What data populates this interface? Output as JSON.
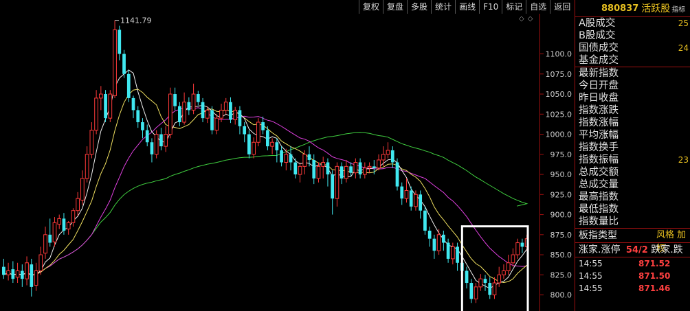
{
  "toolbar": {
    "buttons": [
      "复权",
      "复盘",
      "多股",
      "统计",
      "画线",
      "F10",
      "标记",
      "自选",
      "返回"
    ]
  },
  "header": {
    "code": "880837",
    "name": "活跃股",
    "badge": "指标"
  },
  "chart": {
    "corner_icons": "◇◇",
    "max_label": "1141.79"
  },
  "panel": {
    "rows": [
      {
        "label": "A股成交",
        "value": "25"
      },
      {
        "label": "B股成交",
        "value": ""
      },
      {
        "label": "国债成交",
        "value": "24"
      },
      {
        "label": "基金成交",
        "value": ""
      },
      {
        "label": "最新指数",
        "value": ""
      },
      {
        "label": "今日开盘",
        "value": ""
      },
      {
        "label": "昨日收盘",
        "value": ""
      },
      {
        "label": "指数涨跌",
        "value": ""
      },
      {
        "label": "指数涨幅",
        "value": ""
      },
      {
        "label": "平均涨幅",
        "value": ""
      },
      {
        "label": "指数换手",
        "value": ""
      },
      {
        "label": "指数振幅",
        "value": "23"
      },
      {
        "label": "总成交额",
        "value": ""
      },
      {
        "label": "总成交量",
        "value": ""
      },
      {
        "label": "最高指数",
        "value": ""
      },
      {
        "label": "最低指数",
        "value": ""
      },
      {
        "label": "指数量比",
        "value": ""
      }
    ],
    "style_label": "板指类型",
    "style_value": "风格 加权",
    "rise_label": "涨家.涨停",
    "rise_value": "54/2",
    "fall_label": "跌家.跌",
    "ticks": [
      {
        "time": "14:55",
        "price": "871.52"
      },
      {
        "time": "14:55",
        "price": "871.50"
      },
      {
        "time": "14:55",
        "price": "871.46"
      }
    ]
  },
  "colors": {
    "up": "#ff3a3a",
    "down": "#40e8f0",
    "ma5": "#f0f0f0",
    "ma10": "#f0e060",
    "ma20": "#e040e0",
    "ma60": "#40d040",
    "axis": "#a01010",
    "highlight": "#ffffff"
  },
  "chart_data": {
    "type": "candlestick",
    "ylim": [
      780,
      1150
    ],
    "yticks": [
      800,
      825,
      850,
      875,
      900,
      925,
      950,
      975,
      1000,
      1025,
      1050,
      1075,
      1100
    ],
    "candles": [
      [
        835,
        825,
        845,
        820
      ],
      [
        825,
        830,
        840,
        818
      ],
      [
        832,
        820,
        842,
        815
      ],
      [
        822,
        830,
        840,
        815
      ],
      [
        830,
        820,
        838,
        810
      ],
      [
        820,
        840,
        848,
        812
      ],
      [
        838,
        810,
        845,
        798
      ],
      [
        812,
        830,
        840,
        805
      ],
      [
        830,
        850,
        860,
        825
      ],
      [
        852,
        875,
        885,
        845
      ],
      [
        875,
        865,
        895,
        860
      ],
      [
        866,
        890,
        897,
        860
      ],
      [
        888,
        895,
        900,
        882
      ],
      [
        895,
        880,
        902,
        875
      ],
      [
        882,
        890,
        892,
        875
      ],
      [
        890,
        905,
        908,
        885
      ],
      [
        905,
        920,
        928,
        898
      ],
      [
        918,
        945,
        955,
        912
      ],
      [
        945,
        975,
        985,
        940
      ],
      [
        975,
        1005,
        1015,
        970
      ],
      [
        1005,
        1045,
        1055,
        1000
      ],
      [
        1045,
        1050,
        1060,
        1030
      ],
      [
        1050,
        1020,
        1055,
        1015
      ],
      [
        1020,
        1050,
        1055,
        1015
      ],
      [
        1048,
        1130,
        1141.79,
        1045
      ],
      [
        1130,
        1100,
        1135,
        1092
      ],
      [
        1100,
        1075,
        1105,
        1070
      ],
      [
        1075,
        1045,
        1080,
        1040
      ],
      [
        1045,
        1030,
        1048,
        1020
      ],
      [
        1030,
        1015,
        1035,
        1008
      ],
      [
        1015,
        1005,
        1020,
        995
      ],
      [
        1005,
        990,
        1012,
        985
      ],
      [
        990,
        975,
        995,
        965
      ],
      [
        975,
        1000,
        1005,
        970
      ],
      [
        1000,
        985,
        1008,
        980
      ],
      [
        985,
        1000,
        1010,
        978
      ],
      [
        1000,
        1050,
        1058,
        995
      ],
      [
        1050,
        1035,
        1058,
        1030
      ],
      [
        1035,
        1015,
        1040,
        1010
      ],
      [
        1015,
        1040,
        1052,
        1012
      ],
      [
        1040,
        1030,
        1046,
        1024
      ],
      [
        1030,
        1050,
        1063,
        1025
      ],
      [
        1050,
        1040,
        1054,
        1036
      ],
      [
        1040,
        1020,
        1045,
        1015
      ],
      [
        1020,
        1030,
        1034,
        1014
      ],
      [
        1030,
        1005,
        1035,
        1000
      ],
      [
        1005,
        1020,
        1025,
        1000
      ],
      [
        1020,
        1030,
        1038,
        1015
      ],
      [
        1030,
        1040,
        1045,
        1025
      ],
      [
        1040,
        1018,
        1046,
        1014
      ],
      [
        1018,
        1030,
        1034,
        1012
      ],
      [
        1030,
        1010,
        1035,
        1000
      ],
      [
        1010,
        1000,
        1015,
        990
      ],
      [
        1000,
        975,
        1005,
        970
      ],
      [
        975,
        990,
        996,
        970
      ],
      [
        990,
        1015,
        1020,
        985
      ],
      [
        1015,
        1005,
        1022,
        1000
      ],
      [
        1005,
        985,
        1010,
        980
      ],
      [
        985,
        990,
        995,
        975
      ],
      [
        990,
        980,
        995,
        965
      ],
      [
        980,
        965,
        985,
        960
      ],
      [
        965,
        975,
        982,
        955
      ],
      [
        975,
        965,
        985,
        955
      ],
      [
        965,
        950,
        970,
        945
      ],
      [
        950,
        960,
        965,
        940
      ],
      [
        960,
        975,
        980,
        950
      ],
      [
        975,
        968,
        985,
        960
      ],
      [
        968,
        945,
        975,
        938
      ],
      [
        945,
        960,
        965,
        940
      ],
      [
        960,
        965,
        972,
        945
      ],
      [
        965,
        950,
        970,
        935
      ],
      [
        950,
        920,
        955,
        900
      ],
      [
        920,
        960,
        965,
        910
      ],
      [
        960,
        945,
        965,
        938
      ],
      [
        945,
        960,
        968,
        940
      ],
      [
        960,
        952,
        965,
        948
      ],
      [
        952,
        965,
        970,
        945
      ],
      [
        965,
        950,
        970,
        945
      ],
      [
        950,
        958,
        965,
        945
      ],
      [
        958,
        960,
        965,
        952
      ],
      [
        960,
        958,
        968,
        950
      ],
      [
        958,
        968,
        975,
        955
      ],
      [
        968,
        975,
        985,
        960
      ],
      [
        975,
        980,
        990,
        970
      ],
      [
        980,
        965,
        985,
        958
      ],
      [
        965,
        935,
        970,
        930
      ],
      [
        935,
        920,
        940,
        912
      ],
      [
        920,
        930,
        945,
        915
      ],
      [
        930,
        910,
        935,
        905
      ],
      [
        910,
        925,
        930,
        905
      ],
      [
        925,
        905,
        930,
        895
      ],
      [
        905,
        880,
        910,
        875
      ],
      [
        880,
        870,
        885,
        860
      ],
      [
        870,
        855,
        875,
        845
      ],
      [
        855,
        875,
        882,
        850
      ],
      [
        875,
        865,
        880,
        855
      ],
      [
        865,
        845,
        870,
        840
      ],
      [
        845,
        860,
        865,
        838
      ],
      [
        860,
        840,
        865,
        830
      ],
      [
        840,
        830,
        845,
        822
      ],
      [
        830,
        815,
        835,
        808
      ],
      [
        815,
        795,
        820,
        790
      ],
      [
        795,
        810,
        815,
        790
      ],
      [
        810,
        820,
        826,
        805
      ],
      [
        820,
        815,
        825,
        805
      ],
      [
        815,
        800,
        822,
        795
      ],
      [
        800,
        815,
        822,
        795
      ],
      [
        815,
        825,
        835,
        810
      ],
      [
        825,
        830,
        838,
        820
      ],
      [
        830,
        840,
        850,
        825
      ],
      [
        840,
        850,
        858,
        835
      ],
      [
        850,
        865,
        870,
        845
      ],
      [
        865,
        860,
        870,
        852
      ],
      [
        860,
        870,
        875,
        855
      ]
    ],
    "highlight_box": {
      "x_from_index": 100,
      "x_to_index": 113
    }
  }
}
